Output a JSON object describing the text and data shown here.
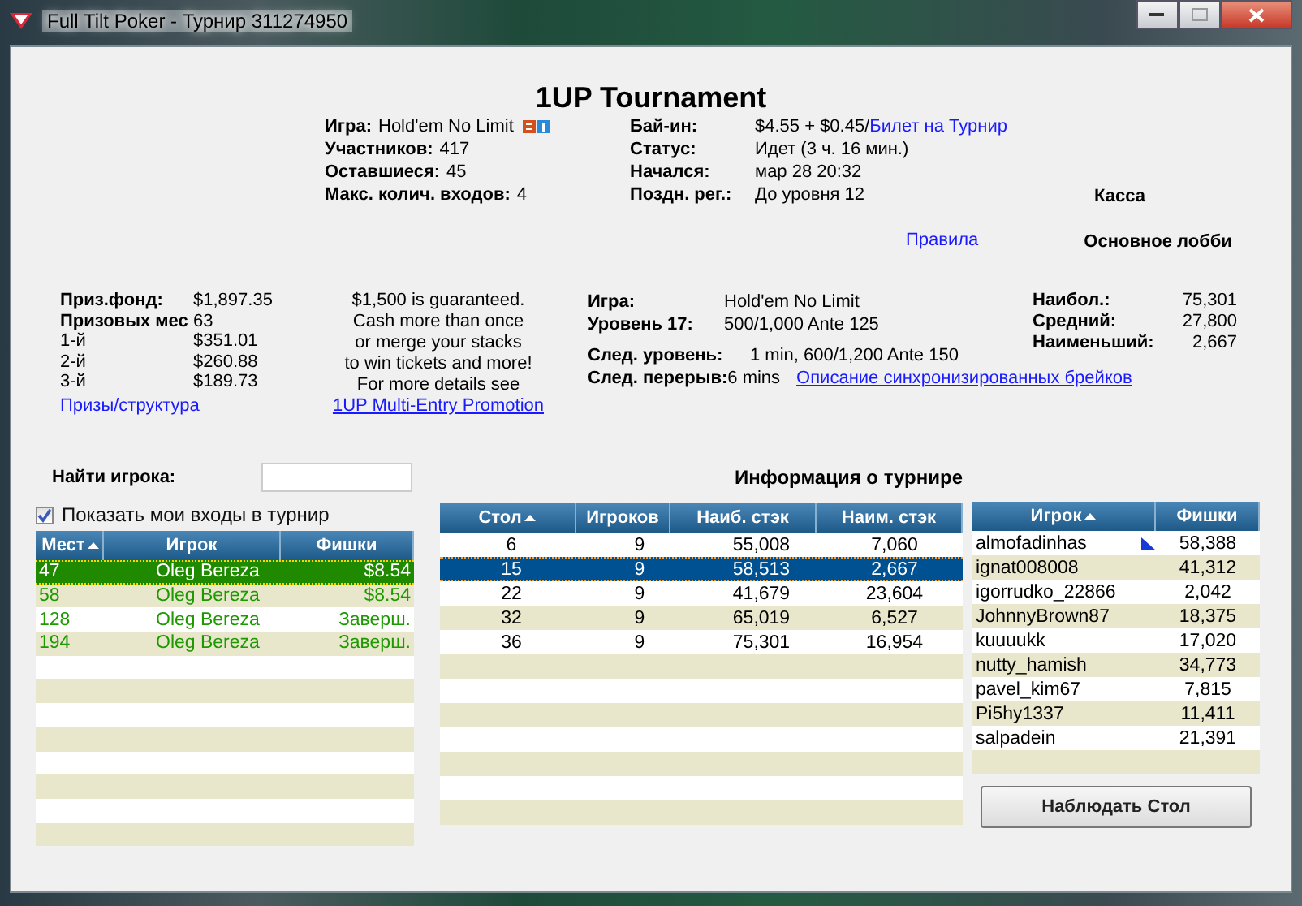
{
  "window": {
    "title": "Full Tilt Poker - Турнир 311274950"
  },
  "heading": "1UP Tournament",
  "info_left": [
    {
      "label": "Игра:",
      "value": "Hold'em No Limit",
      "badges": true
    },
    {
      "label": "Участников:",
      "value": "417",
      "badges": false
    },
    {
      "label": "Оставшиеся:",
      "value": "45",
      "badges": false
    },
    {
      "label": "Макс. колич. входов:",
      "value": "4",
      "badges": false
    }
  ],
  "info_right": [
    {
      "label": "Бай-ин:",
      "value": "$4.55 + $0.45/",
      "link": "Билет на Турнир"
    },
    {
      "label": "Статус:",
      "value": "Идет (3 ч. 16 мин.)"
    },
    {
      "label": "Начался:",
      "value": "мар 28 20:32"
    },
    {
      "label": "Поздн. рег.:",
      "value": "До уровня 12"
    }
  ],
  "cashier": "Касса",
  "rules_link": "Правила",
  "main_lobby": "Основное лобби",
  "prizes": {
    "pool_label": "Приз.фонд:",
    "pool": "$1,897.35",
    "places_label": "Призовых мес",
    "places": "63",
    "payouts": [
      {
        "place": "1-й",
        "amount": "$351.01"
      },
      {
        "place": "2-й",
        "amount": "$260.88"
      },
      {
        "place": "3-й",
        "amount": "$189.73"
      }
    ],
    "link": "Призы/структура"
  },
  "promo": {
    "lines": [
      "$1,500 is guaranteed.",
      "Cash more than once",
      "or merge your stacks",
      "to win tickets and more!",
      "For more details see"
    ],
    "link": "1UP Multi-Entry Promotion"
  },
  "level_info": [
    {
      "label": "Игра:",
      "value": "Hold'em No Limit"
    },
    {
      "label": "Уровень 17:",
      "value": "500/1,000 Ante 125"
    }
  ],
  "next_info": [
    {
      "label": "След. уровень:",
      "value": "1 min, 600/1,200 Ante 150"
    },
    {
      "label": "След. перерыв:",
      "value": "6 mins",
      "link": "Описание синхронизированных брейков"
    }
  ],
  "stacks": [
    {
      "label": "Наибол.:",
      "value": "75,301"
    },
    {
      "label": "Средний:",
      "value": "27,800"
    },
    {
      "label": "Наименьший:",
      "value": "2,667"
    }
  ],
  "find_player": {
    "label": "Найти игрока:"
  },
  "show_my_entries": {
    "label": "Показать мои входы в турнир",
    "checked": true
  },
  "my_entries": {
    "columns": [
      {
        "label": "Мест",
        "sorted": true
      },
      {
        "label": "Игрок",
        "sorted": false
      },
      {
        "label": "Фишки",
        "sorted": false
      }
    ],
    "rows": [
      {
        "cells": [
          "47",
          "Oleg Bereza",
          "$8.54"
        ],
        "selected": true
      },
      {
        "cells": [
          "58",
          "Oleg Bereza",
          "$8.54"
        ],
        "selected": false
      },
      {
        "cells": [
          "128",
          "Oleg Bereza",
          "Заверш."
        ],
        "selected": false
      },
      {
        "cells": [
          "194",
          "Oleg Bereza",
          "Заверш."
        ],
        "selected": false
      }
    ]
  },
  "tables_info": {
    "title": "Информация о турнире",
    "columns": [
      {
        "label": "Стол",
        "sorted": true
      },
      {
        "label": "Игроков",
        "sorted": false
      },
      {
        "label": "Наиб. стэк",
        "sorted": false
      },
      {
        "label": "Наим. стэк",
        "sorted": false
      }
    ],
    "rows": [
      {
        "cells": [
          "6",
          "9",
          "55,008",
          "7,060"
        ],
        "selected": false
      },
      {
        "cells": [
          "15",
          "9",
          "58,513",
          "2,667"
        ],
        "selected": true
      },
      {
        "cells": [
          "22",
          "9",
          "41,679",
          "23,604"
        ],
        "selected": false
      },
      {
        "cells": [
          "32",
          "9",
          "65,019",
          "6,527"
        ],
        "selected": false
      },
      {
        "cells": [
          "36",
          "9",
          "75,301",
          "16,954"
        ],
        "selected": false
      }
    ]
  },
  "players": {
    "columns": [
      {
        "label": "Игрок",
        "sorted": true
      },
      {
        "label": "Фишки",
        "sorted": false
      }
    ],
    "rows": [
      {
        "cells": [
          "almofadinhas",
          "58,388"
        ],
        "marked": true
      },
      {
        "cells": [
          "ignat008008",
          "41,312"
        ],
        "marked": false
      },
      {
        "cells": [
          "igorrudko_22866",
          "2,042"
        ],
        "marked": false
      },
      {
        "cells": [
          "JohnnyBrown87",
          "18,375"
        ],
        "marked": false
      },
      {
        "cells": [
          "kuuuukk",
          "17,020"
        ],
        "marked": false
      },
      {
        "cells": [
          "nutty_hamish",
          "34,773"
        ],
        "marked": false
      },
      {
        "cells": [
          "pavel_kim67",
          "7,815"
        ],
        "marked": false
      },
      {
        "cells": [
          "Pi5hy1337",
          "11,411"
        ],
        "marked": false
      },
      {
        "cells": [
          "salpadein",
          "21,391"
        ],
        "marked": false
      }
    ]
  },
  "watch_button": "Наблюдать Стол"
}
